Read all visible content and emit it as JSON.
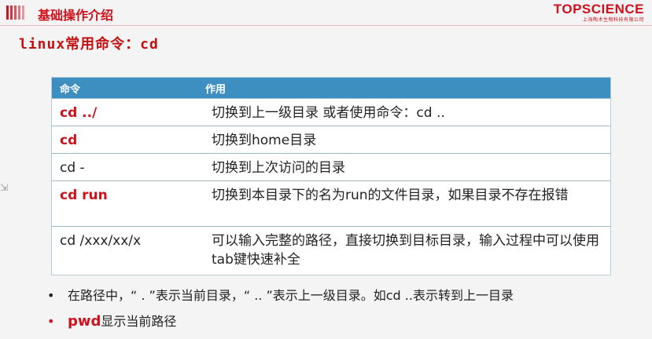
{
  "header": {
    "title": "基础操作介绍",
    "brand_name": "TOPSCIENCE",
    "brand_sub": "上海陶术生物科技有限公司"
  },
  "subtitle": "linux常用命令：cd",
  "table": {
    "columns": [
      "命令",
      "作用"
    ],
    "rows": [
      {
        "cmd": "cd ../",
        "desc": "切换到上一级目录 或者使用命令：cd ..",
        "highlight": true
      },
      {
        "cmd": "cd",
        "desc": "切换到home目录",
        "highlight": true
      },
      {
        "cmd": "cd -",
        "desc": "切换到上次访问的目录",
        "highlight": false
      },
      {
        "cmd": "cd run",
        "desc": "切换到本目录下的名为run的文件目录，如果目录不存在报错",
        "highlight": true
      },
      {
        "cmd": "cd /xxx/xx/x",
        "desc": "可以输入完整的路径，直接切换到目标目录，输入过程中可以使用tab键快速补全",
        "highlight": false
      }
    ]
  },
  "bullets": [
    {
      "text": "在路径中，“ . ”表示当前目录，“ .. ”表示上一级目录。如cd ..表示转到上一目录"
    },
    {
      "prefix": "pwd",
      "text": "显示当前路径"
    }
  ],
  "colors": {
    "accent": "#d0101b",
    "table_header": "#3c8fc0"
  }
}
